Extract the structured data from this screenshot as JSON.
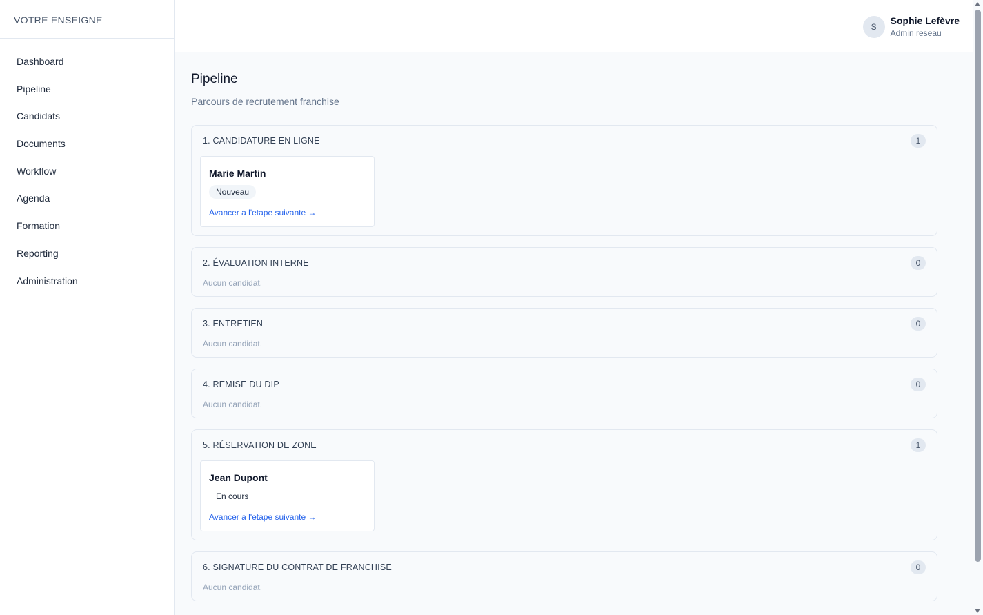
{
  "brand": "VOTRE ENSEIGNE",
  "nav": [
    {
      "label": "Dashboard"
    },
    {
      "label": "Pipeline"
    },
    {
      "label": "Candidats"
    },
    {
      "label": "Documents"
    },
    {
      "label": "Workflow"
    },
    {
      "label": "Agenda"
    },
    {
      "label": "Formation"
    },
    {
      "label": "Reporting"
    },
    {
      "label": "Administration"
    }
  ],
  "user": {
    "initial": "S",
    "name": "Sophie Lefèvre",
    "role": "Admin reseau"
  },
  "page": {
    "title": "Pipeline",
    "subtitle": "Parcours de recrutement franchise"
  },
  "empty_text": "Aucun candidat.",
  "stages": [
    {
      "title": "1. CANDIDATURE EN LIGNE",
      "count": "1",
      "card": {
        "name": "Marie Martin",
        "badge": "Nouveau",
        "action": "Avancer a l'etape suivante →"
      }
    },
    {
      "title": "2. ÉVALUATION INTERNE",
      "count": "0"
    },
    {
      "title": "3. ENTRETIEN",
      "count": "0"
    },
    {
      "title": "4. REMISE DU DIP",
      "count": "0"
    },
    {
      "title": "5. RÉSERVATION DE ZONE",
      "count": "1",
      "card": {
        "name": "Jean Dupont",
        "badge": "En cours",
        "action": "Avancer a l'etape suivante →"
      }
    },
    {
      "title": "6. SIGNATURE DU CONTRAT DE FRANCHISE",
      "count": "0"
    }
  ]
}
